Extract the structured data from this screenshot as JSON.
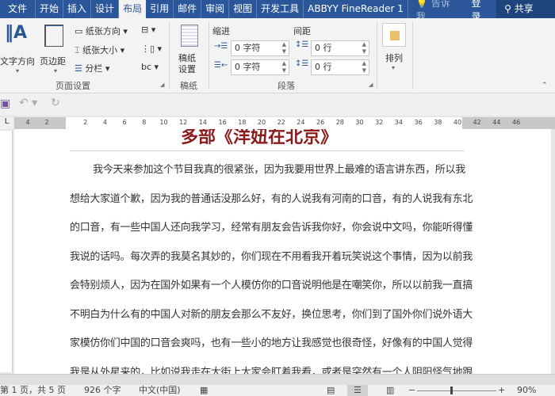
{
  "tabs": [
    "文件",
    "开始",
    "插入",
    "设计",
    "布局",
    "引用",
    "邮件",
    "审阅",
    "视图",
    "开发工具",
    "ABBYY FineReader 1"
  ],
  "tell_me": "告诉我...",
  "login": "登录",
  "share": "共享",
  "ribbon": {
    "text_direction": "文字方向",
    "margins": "页边距",
    "orientation": "纸张方向",
    "size": "纸张大小",
    "columns": "分栏",
    "page_setup_group": "页面设置",
    "draft_paper": "稿纸\n设置",
    "draft_group": "稿纸",
    "indent_label": "缩进",
    "spacing_label": "间距",
    "indent_left": "0 字符",
    "indent_right": "0 字符",
    "spacing_before": "0 行",
    "spacing_after": "0 行",
    "paragraph_group": "段落",
    "arrange": "排列"
  },
  "ruler_ticks": [
    "4",
    "2",
    "2",
    "4",
    "6",
    "8",
    "10",
    "12",
    "14",
    "16",
    "18",
    "20",
    "22",
    "24",
    "26",
    "28",
    "30",
    "32",
    "34",
    "36",
    "38",
    "40",
    "42",
    "44",
    "46"
  ],
  "document": {
    "title": "多部《洋妞在北京》",
    "lines": [
      "我今天来参加这个节目我真的很紧张，因为我要用世界上最难的语言讲东西，所以我",
      "想给大家道个歉，因为我的普通话没那么好，有的人说我有河南的口音，有的人说我有东北",
      "的口音，有一些中国人还向我学习，经常有朋友会告诉我你好，你会说中文吗，你能听得懂",
      "我说的话吗。每次弄的我莫名其妙的，你们现在不用看我开着玩笑说这个事情，因为以前我",
      "会特别烦人，因为在国外如果有一个人模仿你的口音说明他是在嘲笑你，所以以前我一直搞",
      "不明白为什么有的中国人对新的朋友会那么不友好，换位思考，你们到了国外你们说外语大",
      "家模仿你们中国的口音会爽吗，也有一些小的地方让我感觉也很奇怪，好像有的中国人觉得",
      "我是从外星来的，比如说我走在大街上大家会盯着我看，或者是突然有一个人阴阳怪气地跟"
    ]
  },
  "status": {
    "page": "第 1 页，共 5 页",
    "words": "926 个字",
    "language": "中文(中国)",
    "zoom": "90%"
  }
}
